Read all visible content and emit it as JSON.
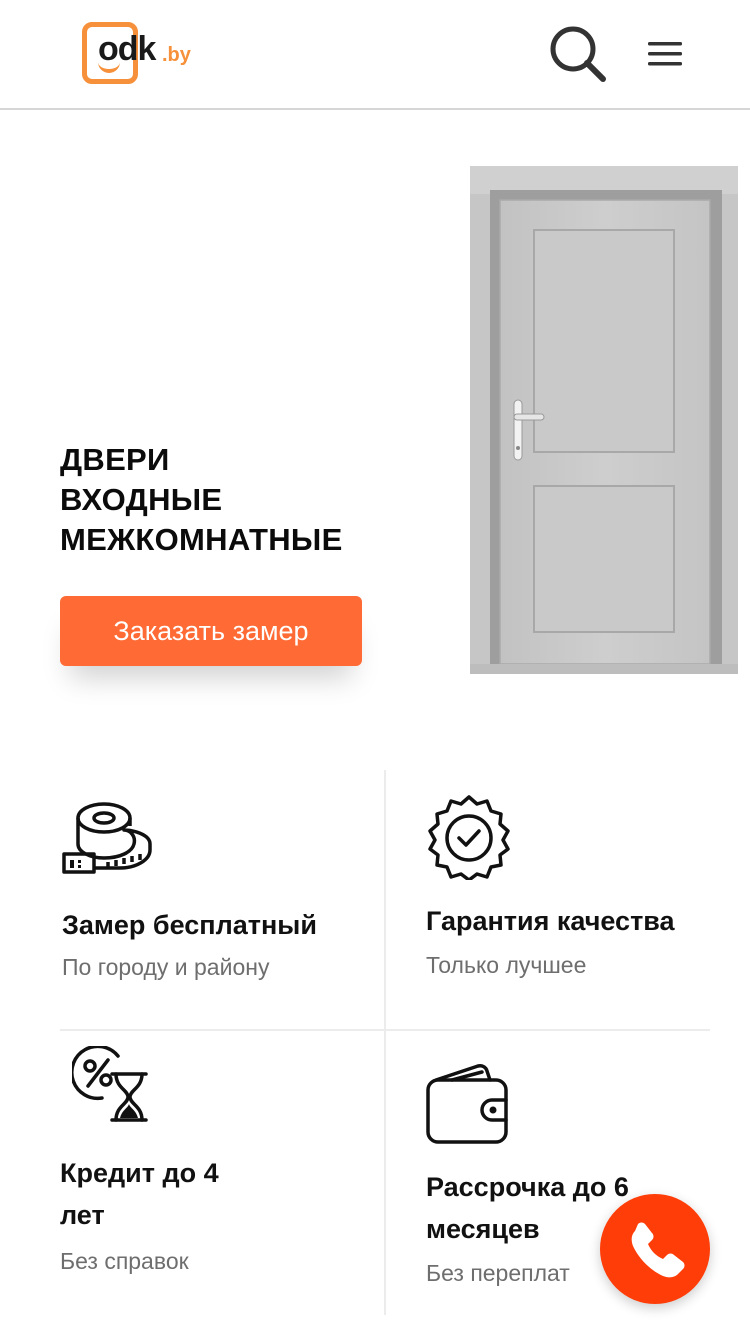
{
  "header": {
    "logo_text": "odk",
    "logo_tld": ".by",
    "icons": {
      "search": "search-icon",
      "menu": "hamburger-menu-icon"
    }
  },
  "hero": {
    "title_lines": [
      "ДВЕРИ",
      "ВХОДНЫЕ",
      "МЕЖКОМНАТНЫЕ"
    ],
    "cta_label": "Заказать замер"
  },
  "features": [
    {
      "icon": "measuring-tape-icon",
      "title": "Замер бесплатный",
      "subtitle": "По городу и району"
    },
    {
      "icon": "quality-badge-icon",
      "title": "Гарантия качества",
      "subtitle": "Только лучшее"
    },
    {
      "icon": "percent-hourglass-icon",
      "title_lines": [
        "Кредит до 4",
        "лет"
      ],
      "subtitle": "Без справок"
    },
    {
      "icon": "wallet-icon",
      "title_lines": [
        "Рассрочка до 6",
        "месяцев"
      ],
      "subtitle": "Без переплат"
    }
  ],
  "call_button": {
    "icon": "phone-icon"
  },
  "colors": {
    "accent": "#ff6a35",
    "logo_orange": "#f6903a",
    "call_button": "#ff3d08"
  }
}
